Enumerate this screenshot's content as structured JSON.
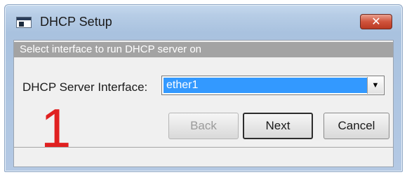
{
  "window": {
    "title": "DHCP Setup",
    "close_glyph": "✕",
    "icon": "app-window-icon"
  },
  "hint": {
    "text": "Select interface to run DHCP server on"
  },
  "form": {
    "interface_label": "DHCP Server Interface:",
    "interface_value": "ether1",
    "dropdown_glyph": "▼"
  },
  "annotation": {
    "step_number": "1",
    "color": "#e02020"
  },
  "buttons": {
    "back": "Back",
    "next": "Next",
    "cancel": "Cancel"
  },
  "status_bar": {
    "text": ""
  },
  "colors": {
    "selection": "#3399ff",
    "hint_bar": "#a3a3a3",
    "close_button": "#d0533c"
  }
}
